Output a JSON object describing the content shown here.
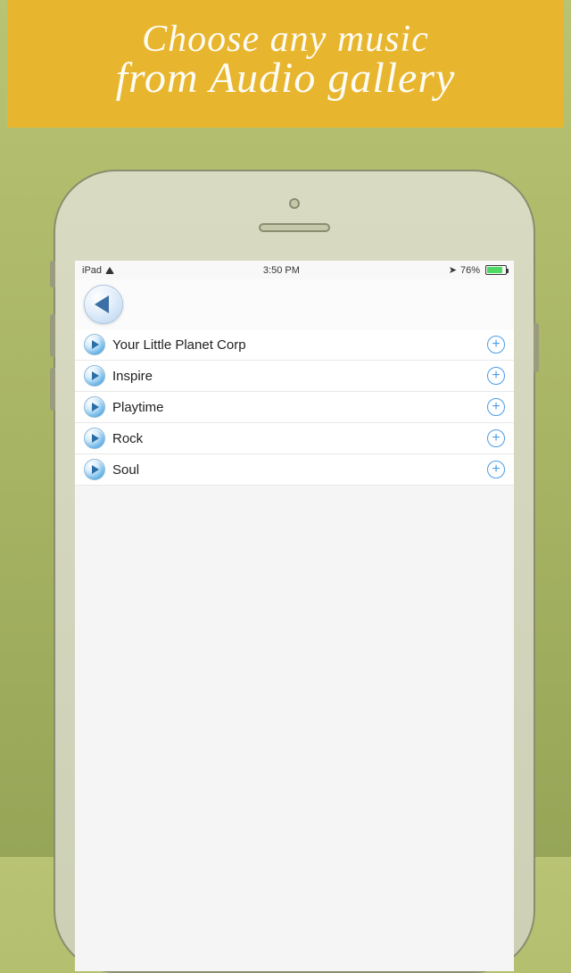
{
  "banner": {
    "line1": "Choose any music",
    "line2": "from Audio gallery"
  },
  "status": {
    "device": "iPad",
    "time": "3:50 PM",
    "battery": "76%"
  },
  "tracks": [
    {
      "label": "Your Little Planet Corp"
    },
    {
      "label": "Inspire"
    },
    {
      "label": "Playtime"
    },
    {
      "label": "Rock"
    },
    {
      "label": "Soul"
    }
  ]
}
